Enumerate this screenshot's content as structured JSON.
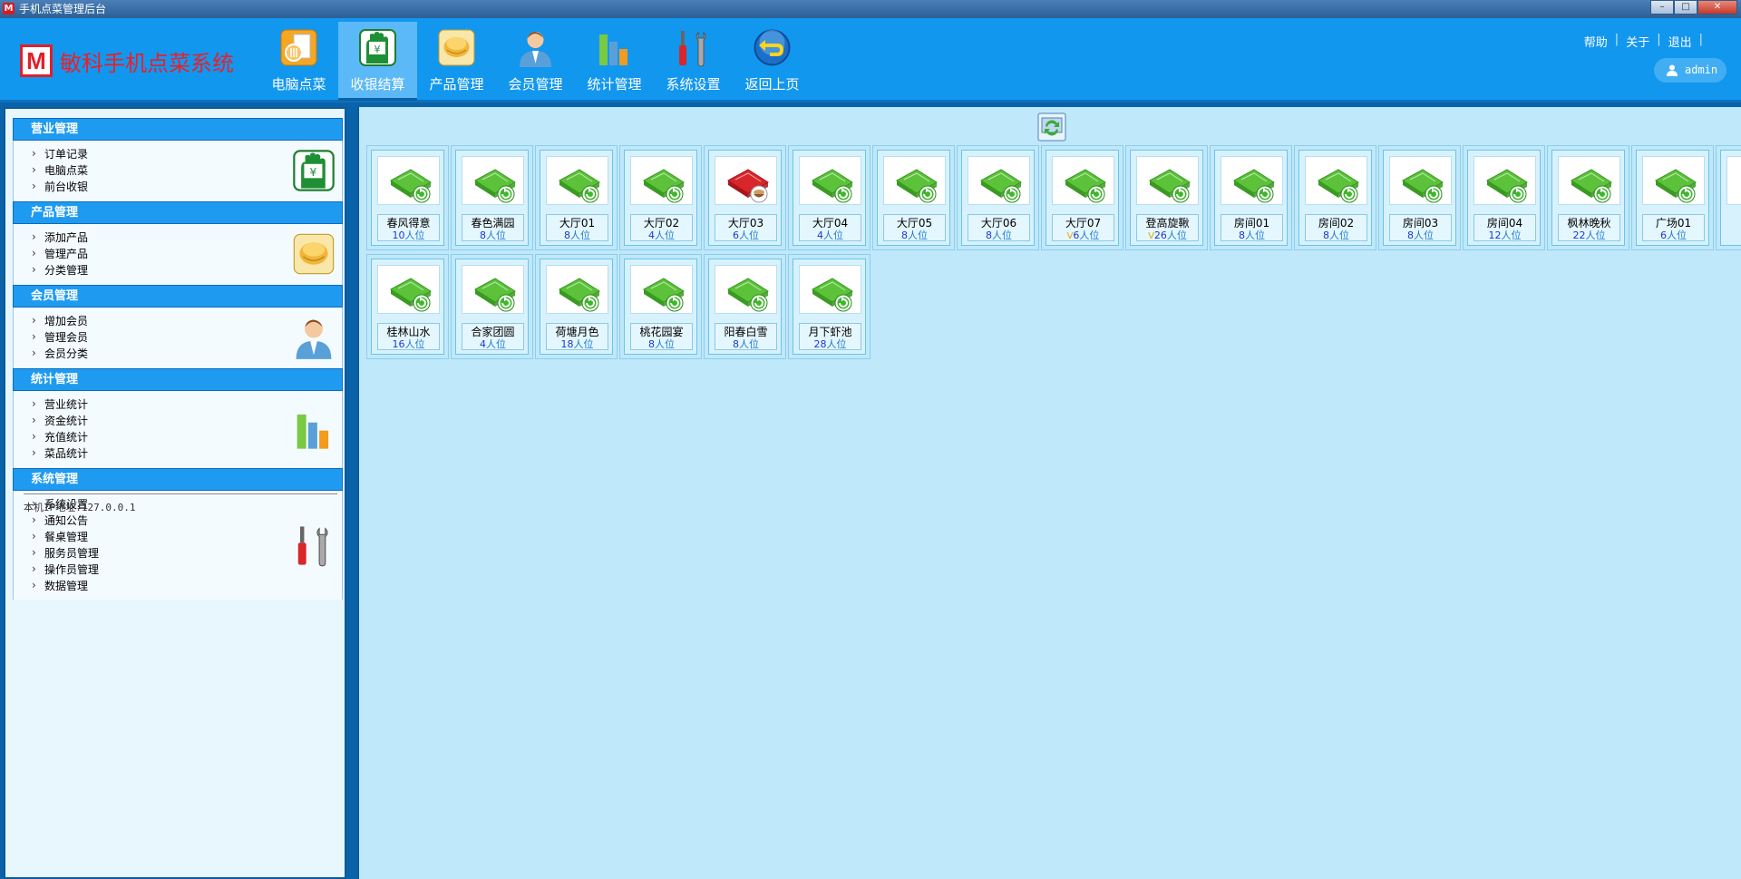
{
  "window": {
    "title": "手机点菜管理后台",
    "app_icon_letter": "M"
  },
  "logo": {
    "mark": "M",
    "text": "敏科手机点菜系统"
  },
  "nav": [
    {
      "label": "电脑点菜",
      "icon": "ordering-icon",
      "active": false
    },
    {
      "label": "收银结算",
      "icon": "cashier-icon",
      "active": true
    },
    {
      "label": "产品管理",
      "icon": "product-icon",
      "active": false
    },
    {
      "label": "会员管理",
      "icon": "member-icon",
      "active": false
    },
    {
      "label": "统计管理",
      "icon": "statistics-icon",
      "active": false
    },
    {
      "label": "系统设置",
      "icon": "settings-icon",
      "active": false
    },
    {
      "label": "返回上页",
      "icon": "back-icon",
      "active": false
    }
  ],
  "top_links": {
    "help": "帮助",
    "about": "关于",
    "logout": "退出",
    "sep": "|"
  },
  "user": {
    "name": "admin"
  },
  "sidebar": {
    "sections": [
      {
        "title": "营业管理",
        "icon": "cashier-icon",
        "items": [
          "订单记录",
          "电脑点菜",
          "前台收银"
        ]
      },
      {
        "title": "产品管理",
        "icon": "product-icon",
        "items": [
          "添加产品",
          "管理产品",
          "分类管理"
        ]
      },
      {
        "title": "会员管理",
        "icon": "member-icon",
        "items": [
          "增加会员",
          "管理会员",
          "会员分类"
        ]
      },
      {
        "title": "统计管理",
        "icon": "statistics-icon",
        "items": [
          "营业统计",
          "资金统计",
          "充值统计",
          "菜品统计"
        ]
      },
      {
        "title": "系统管理",
        "icon": "settings-icon",
        "items": [
          "系统设置",
          "通知公告",
          "餐桌管理",
          "服务员管理",
          "操作员管理",
          "数据管理"
        ]
      }
    ],
    "ip_label": "本机IP地址:127.0.0.1"
  },
  "tables_unit": "人位",
  "tables": [
    {
      "name": "春风得意",
      "seats": "10",
      "status": "free",
      "vip": false
    },
    {
      "name": "春色满园",
      "seats": "8",
      "status": "free",
      "vip": false
    },
    {
      "name": "大厅01",
      "seats": "8",
      "status": "free",
      "vip": false
    },
    {
      "name": "大厅02",
      "seats": "4",
      "status": "free",
      "vip": false
    },
    {
      "name": "大厅03",
      "seats": "6",
      "status": "occupied",
      "vip": false
    },
    {
      "name": "大厅04",
      "seats": "4",
      "status": "free",
      "vip": false
    },
    {
      "name": "大厅05",
      "seats": "8",
      "status": "free",
      "vip": false
    },
    {
      "name": "大厅06",
      "seats": "8",
      "status": "free",
      "vip": false
    },
    {
      "name": "大厅07",
      "seats": "6",
      "status": "free",
      "vip": true
    },
    {
      "name": "登高旋鞦",
      "seats": "26",
      "status": "free",
      "vip": true
    },
    {
      "name": "房间01",
      "seats": "8",
      "status": "free",
      "vip": false
    },
    {
      "name": "房间02",
      "seats": "8",
      "status": "free",
      "vip": false
    },
    {
      "name": "房间03",
      "seats": "8",
      "status": "free",
      "vip": false
    },
    {
      "name": "房间04",
      "seats": "12",
      "status": "free",
      "vip": false
    },
    {
      "name": "枫林晚秋",
      "seats": "22",
      "status": "free",
      "vip": false
    },
    {
      "name": "广场01",
      "seats": "6",
      "status": "free",
      "vip": false
    },
    {
      "name": "桂林山水",
      "seats": "16",
      "status": "free",
      "vip": false
    },
    {
      "name": "合家团圆",
      "seats": "4",
      "status": "free",
      "vip": false
    },
    {
      "name": "荷塘月色",
      "seats": "18",
      "status": "free",
      "vip": false
    },
    {
      "name": "桃花园宴",
      "seats": "8",
      "status": "free",
      "vip": false
    },
    {
      "name": "阳春白雪",
      "seats": "8",
      "status": "free",
      "vip": false
    },
    {
      "name": "月下虾池",
      "seats": "28",
      "status": "free",
      "vip": false
    }
  ],
  "vip_mark": "V",
  "colors": {
    "header": "#1297ee",
    "sidebar_head": "#1e9bf0",
    "main_bg": "#bfe8fb",
    "logo_red": "#e8202a",
    "free_green": "#3fb62b",
    "occupied_red": "#d8262b"
  },
  "window_buttons": {
    "min": "–",
    "max": "□",
    "close": "✕"
  }
}
